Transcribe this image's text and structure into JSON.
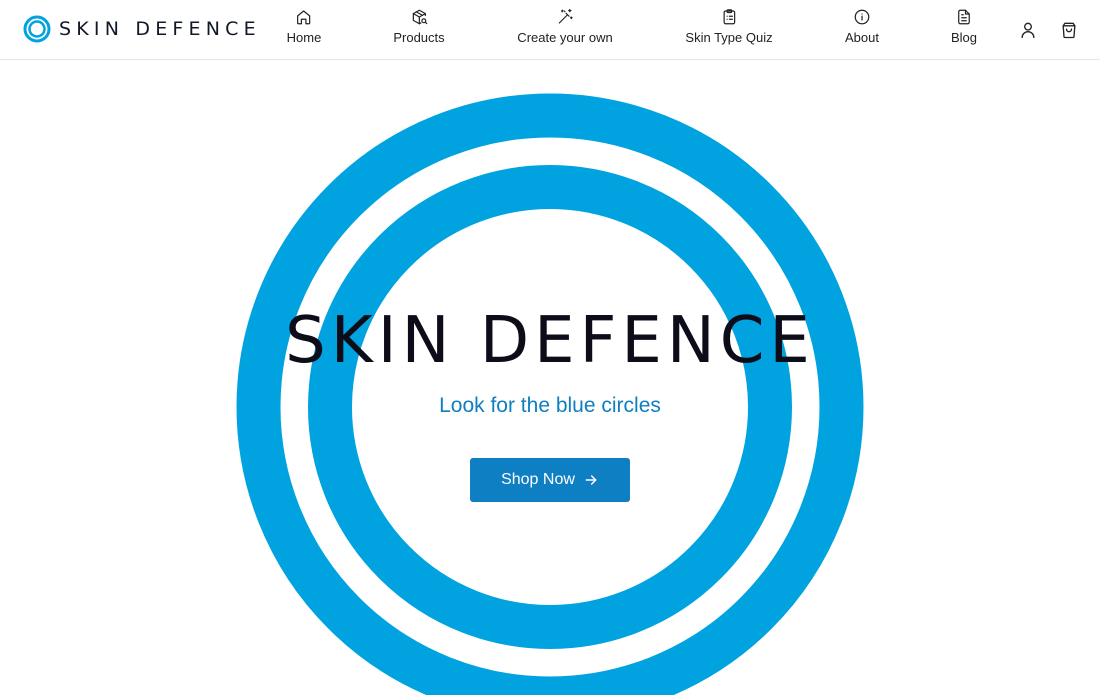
{
  "brand": {
    "name": "SKIN DEFENCE",
    "color": "#00a3e0"
  },
  "nav": {
    "items": [
      {
        "label": "Home",
        "icon": "home-icon"
      },
      {
        "label": "Products",
        "icon": "package-search-icon"
      },
      {
        "label": "Create your own",
        "icon": "magic-wand-icon"
      },
      {
        "label": "Skin Type Quiz",
        "icon": "clipboard-list-icon"
      },
      {
        "label": "About",
        "icon": "info-icon"
      },
      {
        "label": "Blog",
        "icon": "document-icon"
      }
    ],
    "account_icon": "user-icon",
    "cart_icon": "shopping-bag-icon"
  },
  "hero": {
    "title": "SKIN DEFENCE",
    "subtitle": "Look for the blue circles",
    "cta_label": "Shop Now",
    "cta_icon": "arrow-right-icon",
    "ring_color": "#00a3e0",
    "button_color": "#0f7fc3",
    "subtitle_color": "#0f7fc0"
  }
}
